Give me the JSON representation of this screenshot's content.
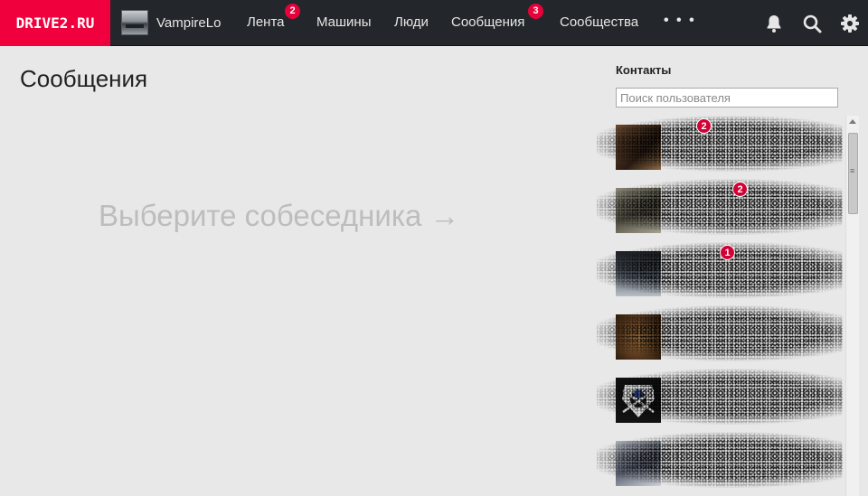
{
  "header": {
    "logo": "DRIVE2.RU",
    "user_name": "VampireLo",
    "nav": [
      {
        "label": "Лента",
        "badge": "2"
      },
      {
        "label": "Машины"
      },
      {
        "label": "Люди"
      },
      {
        "label": "Сообщения",
        "badge": "3"
      },
      {
        "label": "Сообщества"
      }
    ],
    "more": "• • •",
    "icons": [
      "bell-icon",
      "search-icon",
      "gear-icon"
    ]
  },
  "main": {
    "title": "Сообщения",
    "empty_prompt": "Выберите собеседника →"
  },
  "contacts": {
    "title": "Контакты",
    "search_placeholder": "Поиск пользователя",
    "items": [
      {
        "badge": "2",
        "close": "×"
      },
      {
        "badge": "2",
        "close": "×"
      },
      {
        "badge": "1",
        "close": "×"
      },
      {
        "close": "×"
      },
      {
        "close": "×"
      },
      {
        "close": "×"
      }
    ]
  },
  "colors": {
    "accent": "#f0003c",
    "topbar": "#23272b",
    "background": "#e8e8e8",
    "badge": "#e8003a",
    "link": "#2b4f8c"
  }
}
